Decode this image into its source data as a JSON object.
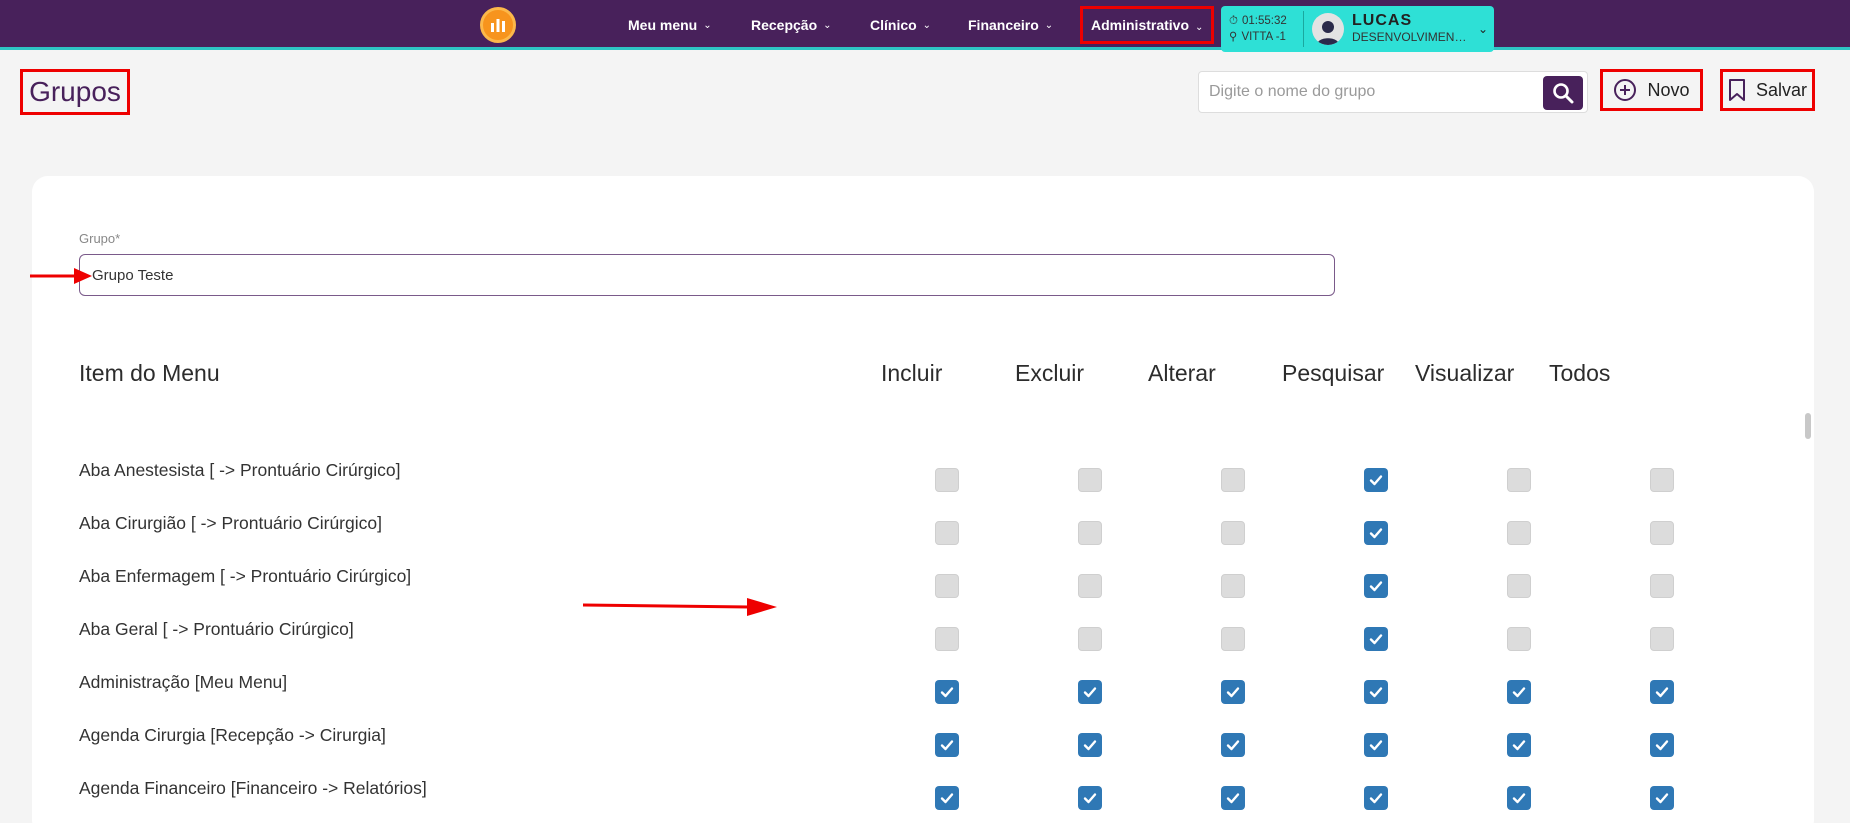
{
  "nav": {
    "items": [
      {
        "label": "Meu menu"
      },
      {
        "label": "Recepção"
      },
      {
        "label": "Clínico"
      },
      {
        "label": "Financeiro"
      },
      {
        "label": "Administrativo"
      }
    ]
  },
  "user": {
    "time": "01:55:32",
    "location": "VITTA -1",
    "name": "LUCAS",
    "role": "DESENVOLVIMENTO"
  },
  "header": {
    "title": "Grupos",
    "search_placeholder": "Digite o nome do grupo",
    "novo_label": "Novo",
    "salvar_label": "Salvar"
  },
  "form": {
    "group_label": "Grupo*",
    "group_value": "Grupo Teste"
  },
  "table": {
    "columns": [
      "Item do Menu",
      "Incluir",
      "Excluir",
      "Alterar",
      "Pesquisar",
      "Visualizar",
      "Todos"
    ],
    "rows": [
      {
        "label": "Aba Anestesista [ -> Prontuário Cirúrgico]",
        "checks": [
          false,
          false,
          false,
          true,
          false,
          false
        ]
      },
      {
        "label": "Aba Cirurgião [ -> Prontuário Cirúrgico]",
        "checks": [
          false,
          false,
          false,
          true,
          false,
          false
        ]
      },
      {
        "label": "Aba Enfermagem [ -> Prontuário Cirúrgico]",
        "checks": [
          false,
          false,
          false,
          true,
          false,
          false
        ]
      },
      {
        "label": "Aba Geral [ -> Prontuário Cirúrgico]",
        "checks": [
          false,
          false,
          false,
          true,
          false,
          false
        ]
      },
      {
        "label": "Administração [Meu Menu]",
        "checks": [
          true,
          true,
          true,
          true,
          true,
          true
        ]
      },
      {
        "label": "Agenda Cirurgia [Recepção -> Cirurgia]",
        "checks": [
          true,
          true,
          true,
          true,
          true,
          true
        ]
      },
      {
        "label": "Agenda Financeiro [Financeiro -> Relatórios]",
        "checks": [
          true,
          true,
          true,
          true,
          true,
          true
        ]
      }
    ]
  },
  "colors": {
    "topbar": "#48215b",
    "accent": "#2ee0d6",
    "checked": "#2f78b5",
    "highlight": "#e00000"
  }
}
